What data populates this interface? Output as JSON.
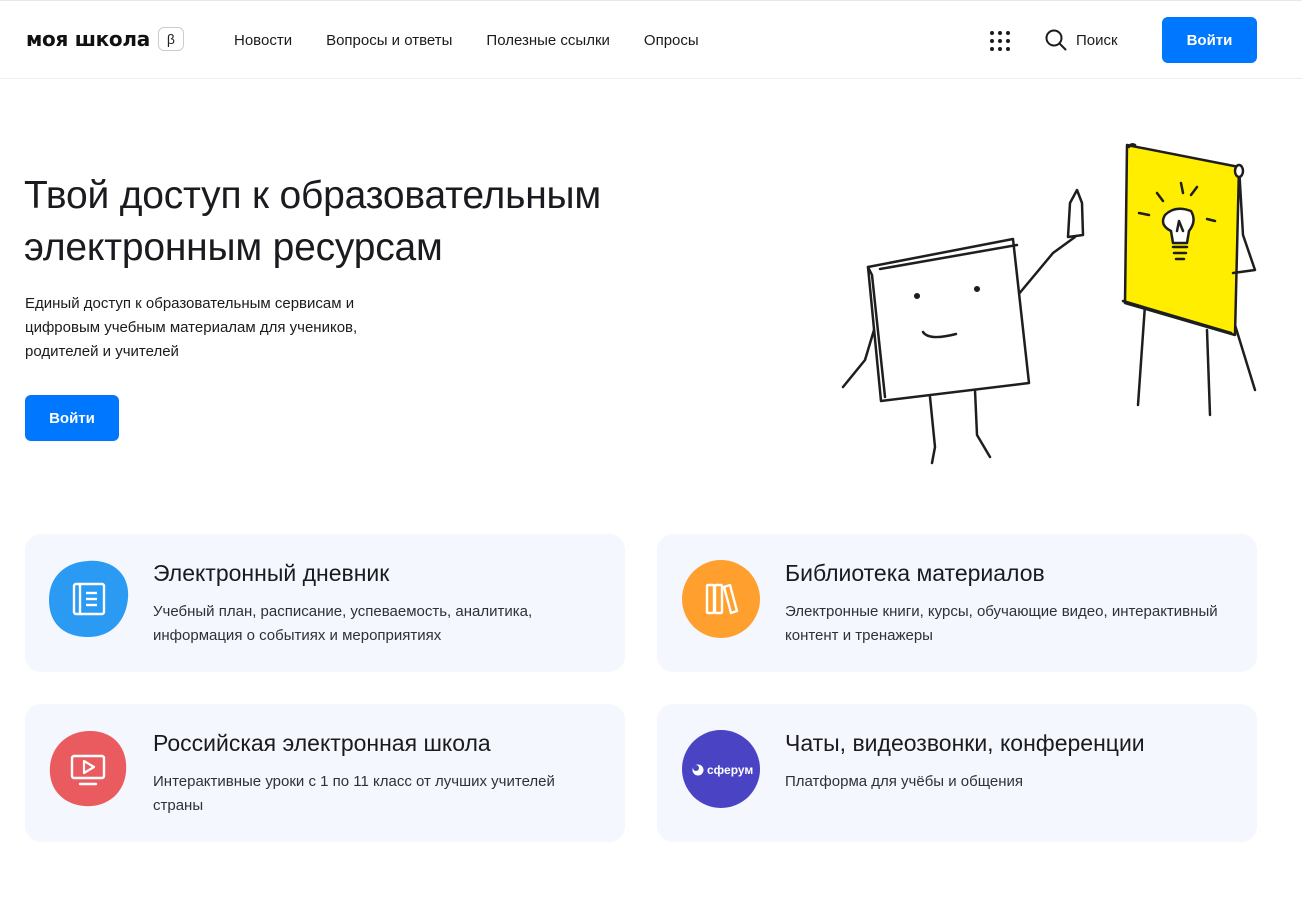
{
  "header": {
    "logo_text": "моя школа",
    "logo_badge": "β",
    "nav": [
      {
        "label": "Новости"
      },
      {
        "label": "Вопросы и ответы"
      },
      {
        "label": "Полезные ссылки"
      },
      {
        "label": "Опросы"
      }
    ],
    "apps_icon": "grid-dots-icon",
    "search_label": "Поиск",
    "search_icon": "search-icon",
    "login_label": "Войти"
  },
  "hero": {
    "title": "Твой доступ к образовательным электронным ресурсам",
    "subtitle": "Единый доступ к образовательным сервисам и цифровым учебным материалам для учеников, родителей и учителей",
    "button_label": "Войти"
  },
  "cards": [
    {
      "title": "Электронный дневник",
      "desc": "Учебный план, расписание, успеваемость, аналитика, информация о событиях и мероприятиях",
      "icon": "diary-icon",
      "color": "#2a9af3"
    },
    {
      "title": "Библиотека материалов",
      "desc": "Электронные книги, курсы, обучающие видео, интерактивный контент и тренажеры",
      "icon": "books-icon",
      "color": "#ff9f2e"
    },
    {
      "title": "Российская электронная школа",
      "desc": "Интерактивные уроки с 1 по 11 класс от лучших учителей страны",
      "icon": "video-lesson-icon",
      "color": "#ea5b5f"
    },
    {
      "title": "Чаты, видеозвонки, конференции",
      "desc": "Платформа для учёбы и общения",
      "icon": "sferum-logo-icon",
      "color": "#4a44c4",
      "badge_text": "сферум"
    }
  ],
  "colors": {
    "accent": "#0077ff",
    "card_bg": "#f4f7fd",
    "yellow": "#ffee00"
  }
}
